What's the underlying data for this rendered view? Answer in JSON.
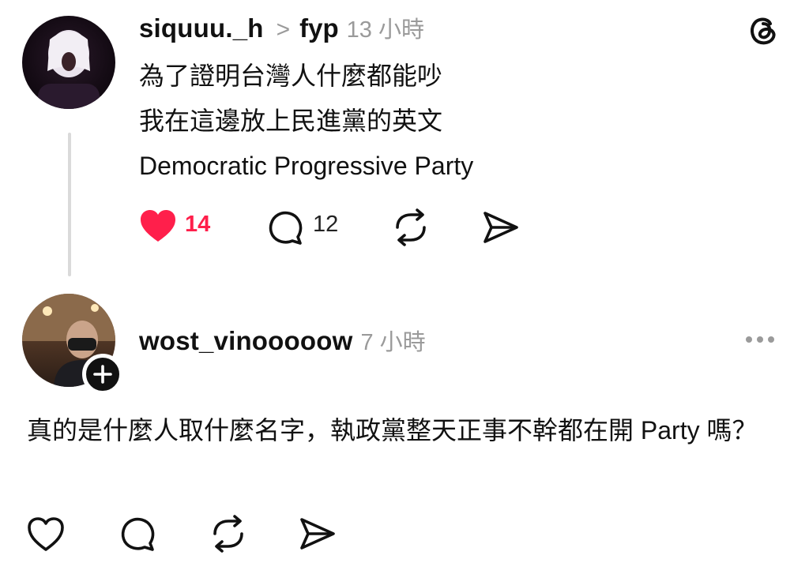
{
  "post": {
    "username": "siquuu._h",
    "separator": ">",
    "tag": "fyp",
    "time": "13 小時",
    "lines": [
      "為了證明台灣人什麼都能吵",
      "我在這邊放上民進黨的英文",
      "Democratic Progressive Party"
    ],
    "likes": "14",
    "replies": "12"
  },
  "reply": {
    "username": "wost_vinooooow",
    "time": "7 小時",
    "text": "真的是什麼人取什麼名字，執政黨整天正事不幹都在開 Party 嗎？"
  },
  "colors": {
    "like_red": "#ff1f4b",
    "muted": "#9a9a9a"
  },
  "icons": [
    "threads-logo-icon",
    "heart-filled-icon",
    "comment-icon",
    "repost-icon",
    "share-icon",
    "more-icon",
    "plus-icon"
  ]
}
